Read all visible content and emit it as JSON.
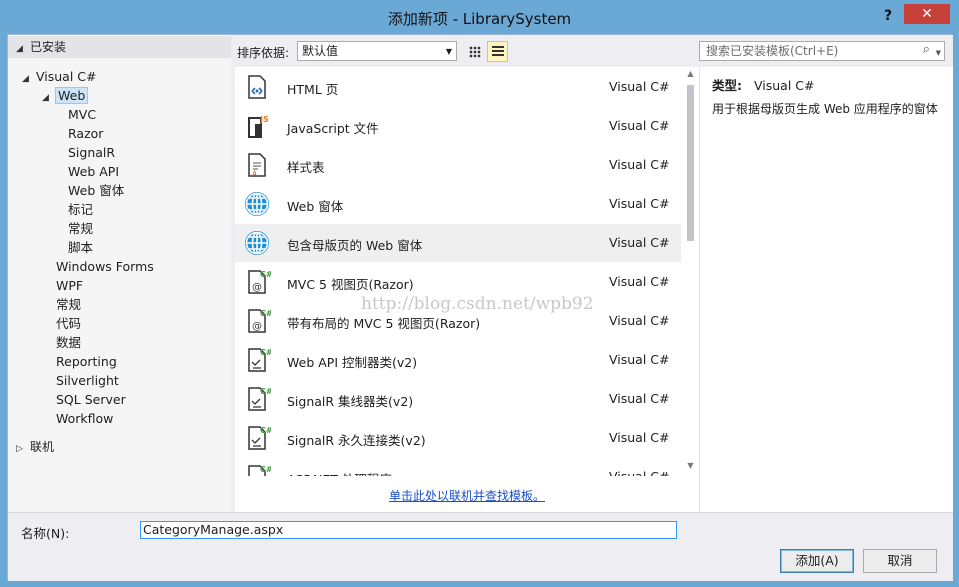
{
  "window": {
    "title": "添加新项 - LibrarySystem",
    "help": "?",
    "close": "✕"
  },
  "left": {
    "installed_header": "已安装",
    "tree": [
      {
        "label": "Visual C#",
        "level": 0,
        "expander": "◢",
        "selected": false
      },
      {
        "label": "Web",
        "level": 1,
        "expander": "◢",
        "selected": true
      },
      {
        "label": "MVC",
        "level": 2
      },
      {
        "label": "Razor",
        "level": 2
      },
      {
        "label": "SignalR",
        "level": 2
      },
      {
        "label": "Web API",
        "level": 2
      },
      {
        "label": "Web 窗体",
        "level": 2
      },
      {
        "label": "标记",
        "level": 2
      },
      {
        "label": "常规",
        "level": 2
      },
      {
        "label": "脚本",
        "level": 2
      },
      {
        "label": "Windows Forms",
        "level": 1
      },
      {
        "label": "WPF",
        "level": 1
      },
      {
        "label": "常规",
        "level": 1
      },
      {
        "label": "代码",
        "level": 1
      },
      {
        "label": "数据",
        "level": 1
      },
      {
        "label": "Reporting",
        "level": 1
      },
      {
        "label": "Silverlight",
        "level": 1
      },
      {
        "label": "SQL Server",
        "level": 1
      },
      {
        "label": "Workflow",
        "level": 1
      }
    ],
    "online_header": "联机"
  },
  "toolbar": {
    "sort_label": "排序依据:",
    "sort_value": "默认值",
    "search_placeholder": "搜索已安装模板(Ctrl+E)"
  },
  "templates": [
    {
      "name": "HTML 页",
      "lang": "Visual C#",
      "icon": "html-page-icon"
    },
    {
      "name": "JavaScript 文件",
      "lang": "Visual C#",
      "icon": "javascript-file-icon"
    },
    {
      "name": "样式表",
      "lang": "Visual C#",
      "icon": "stylesheet-icon"
    },
    {
      "name": "Web 窗体",
      "lang": "Visual C#",
      "icon": "web-form-globe-icon"
    },
    {
      "name": "包含母版页的 Web 窗体",
      "lang": "Visual C#",
      "icon": "web-form-master-globe-icon",
      "selected": true
    },
    {
      "name": "MVC 5 视图页(Razor)",
      "lang": "Visual C#",
      "icon": "mvc-view-icon"
    },
    {
      "name": "带有布局的 MVC 5 视图页(Razor)",
      "lang": "Visual C#",
      "icon": "mvc-layout-view-icon"
    },
    {
      "name": "Web API 控制器类(v2)",
      "lang": "Visual C#",
      "icon": "webapi-controller-icon"
    },
    {
      "name": "SignalR 集线器类(v2)",
      "lang": "Visual C#",
      "icon": "signalr-hub-icon"
    },
    {
      "name": "SignalR 永久连接类(v2)",
      "lang": "Visual C#",
      "icon": "signalr-connection-icon"
    },
    {
      "name": "ASP.NET 处理程序",
      "lang": "Visual C#",
      "icon": "handler-icon"
    }
  ],
  "online_link": "单击此处以联机并查找模板。",
  "detail": {
    "type_label": "类型:",
    "type_value": "Visual C#",
    "description": "用于根据母版页生成 Web 应用程序的窗体"
  },
  "bottom": {
    "name_label": "名称(N):",
    "name_value": "CategoryManage.aspx",
    "add_button": "添加(A)",
    "cancel_button": "取消"
  },
  "watermark": "http://blog.csdn.net/wpb92",
  "colors": {
    "title_bar": "#6aa9d6",
    "close_button": "#c7403a",
    "selection": "#cce4f7",
    "link": "#1b4fc7"
  }
}
